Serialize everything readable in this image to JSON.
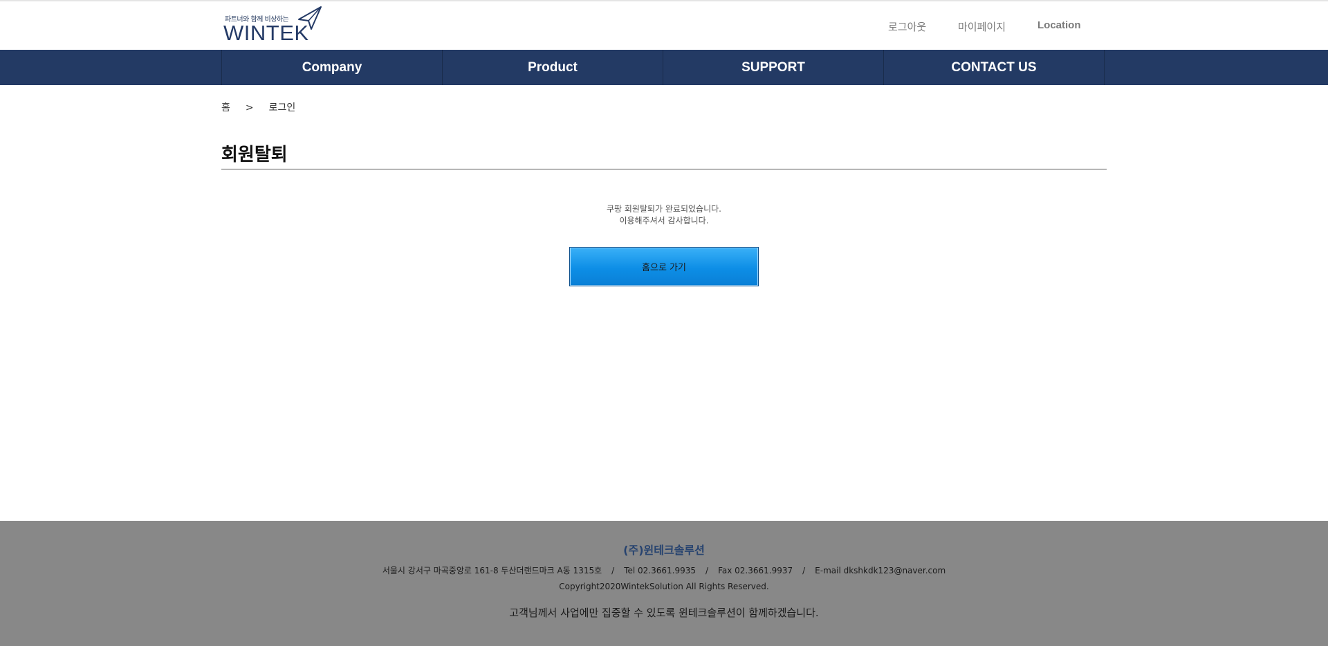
{
  "header": {
    "tagline": "파트너와 함께 비상하는",
    "brand": "WINTEK",
    "links": {
      "logout": "로그아웃",
      "mypage": "마이페이지",
      "location": "Location"
    }
  },
  "nav": {
    "items": [
      {
        "label": "Company"
      },
      {
        "label": "Product"
      },
      {
        "label": "SUPPORT"
      },
      {
        "label": "CONTACT US"
      }
    ]
  },
  "breadcrumb": {
    "home": "홈",
    "separator": ">",
    "current": "로그인"
  },
  "page": {
    "title": "회원탈퇴",
    "message_line1": "쿠팡 회원탈퇴가 완료되었습니다.",
    "message_line2": "이용해주셔서 감사합니다.",
    "home_button": "홈으로 가기"
  },
  "footer": {
    "company": "(주)윈테크솔루션",
    "address": "서울시 강서구 마곡중앙로 161-8 두산더랜드마크 A동 1315호",
    "sep": "/",
    "tel": "Tel 02.3661.9935",
    "fax": "Fax 02.3661.9937",
    "email": "E-mail dkshkdk123@naver.com",
    "copyright": "Copyright2020WintekSolution All Rights Reserved.",
    "slogan": "고객님께서 사업에만 집중할 수 있도록 윈테크솔루션이 함께하겠습니다."
  },
  "colors": {
    "nav_bg": "#233a64",
    "button": "#0d8ee6",
    "footer_bg": "#888888",
    "footer_company": "#27436f"
  },
  "icons": {
    "logo_mark": "paper-plane-icon"
  }
}
